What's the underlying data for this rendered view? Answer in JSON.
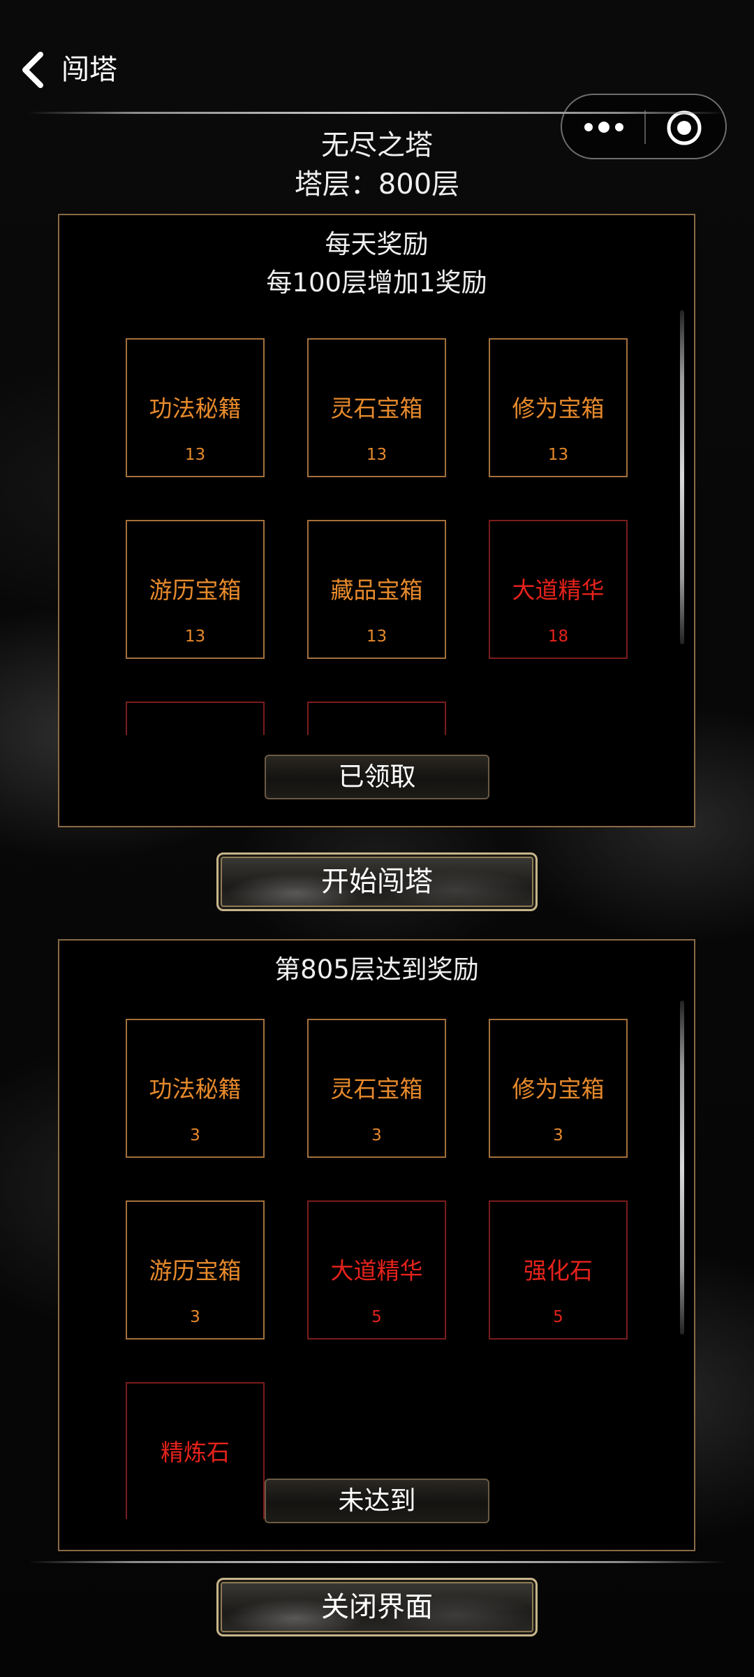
{
  "nav": {
    "title": "闯塔"
  },
  "tower": {
    "name": "无尽之塔",
    "floor_text": "塔层：800层"
  },
  "daily": {
    "title": "每天奖励",
    "subtitle": "每100层增加1奖励",
    "items": [
      {
        "name": "功法秘籍",
        "count": "13",
        "rarity": "orange"
      },
      {
        "name": "灵石宝箱",
        "count": "13",
        "rarity": "orange"
      },
      {
        "name": "修为宝箱",
        "count": "13",
        "rarity": "orange"
      },
      {
        "name": "游历宝箱",
        "count": "13",
        "rarity": "orange"
      },
      {
        "name": "藏品宝箱",
        "count": "13",
        "rarity": "orange"
      },
      {
        "name": "大道精华",
        "count": "18",
        "rarity": "red"
      }
    ],
    "claim_label": "已领取"
  },
  "start_button": "开始闯塔",
  "milestone": {
    "title": "第805层达到奖励",
    "items": [
      {
        "name": "功法秘籍",
        "count": "3",
        "rarity": "orange"
      },
      {
        "name": "灵石宝箱",
        "count": "3",
        "rarity": "orange"
      },
      {
        "name": "修为宝箱",
        "count": "3",
        "rarity": "orange"
      },
      {
        "name": "游历宝箱",
        "count": "3",
        "rarity": "orange"
      },
      {
        "name": "大道精华",
        "count": "5",
        "rarity": "red"
      },
      {
        "name": "强化石",
        "count": "5",
        "rarity": "red"
      },
      {
        "name": "精炼石",
        "count": "",
        "rarity": "red"
      }
    ],
    "status_label": "未达到"
  },
  "close_button": "关闭界面",
  "colors": {
    "orange": "#e78a2c",
    "red": "#e5221b",
    "panel_border": "#8a6a48"
  }
}
